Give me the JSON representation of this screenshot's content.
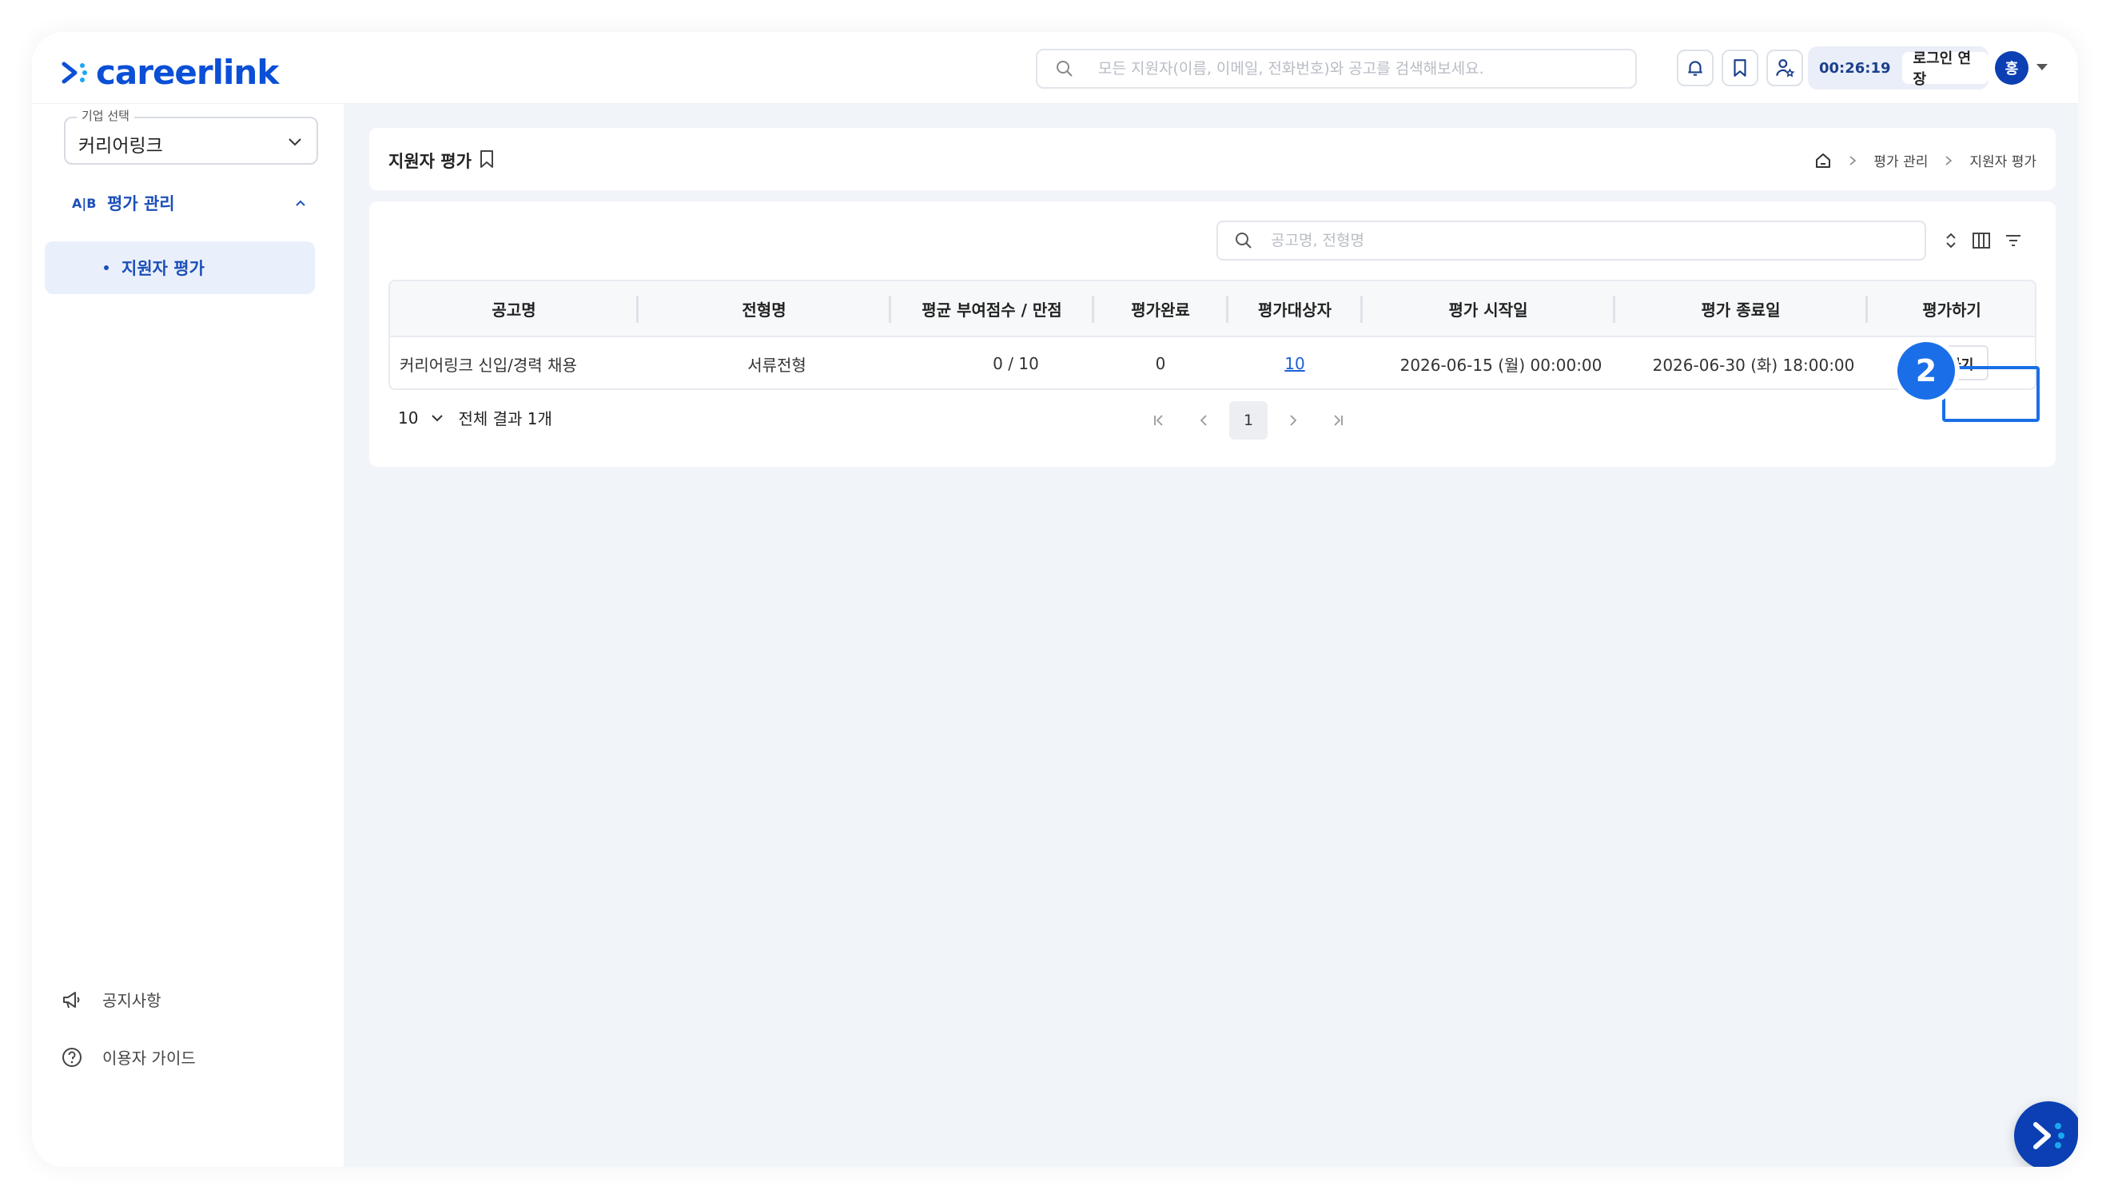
{
  "brand": {
    "name": "careerlink",
    "color": "#0b4fd6"
  },
  "header": {
    "search_placeholder": "모든 지원자(이름, 이메일, 전화번호)와 공고를 검색해보세요.",
    "icons": [
      "bell-icon",
      "bookmark-icon",
      "user-star-icon"
    ],
    "timer": "00:26:19",
    "extend_label": "로그인 연장",
    "avatar_initial": "홍"
  },
  "sidebar": {
    "company_legend": "기업 선택",
    "company_value": "커리어링크",
    "group": {
      "badge": "A|B",
      "label": "평가 관리"
    },
    "active_item": "지원자 평가",
    "bottom": [
      {
        "icon": "megaphone-icon",
        "label": "공지사항"
      },
      {
        "icon": "help-circle-icon",
        "label": "이용자 가이드"
      }
    ]
  },
  "page": {
    "title": "지원자 평가",
    "breadcrumb": [
      "평가 관리",
      "지원자 평가"
    ]
  },
  "table": {
    "search_placeholder": "공고명, 전형명",
    "columns": [
      "공고명",
      "전형명",
      "평균 부여점수 / 만점",
      "평가완료",
      "평가대상자",
      "평가 시작일",
      "평가 종료일",
      "평가하기"
    ],
    "rows": [
      {
        "posting": "커리어링크 신입/경력 채용",
        "stage": "서류전형",
        "score": "0 / 10",
        "completed": "0",
        "targets": "10",
        "start": "2026-06-15 (월) 00:00:00",
        "end": "2026-06-30 (화) 18:00:00",
        "action": "평가하기"
      }
    ],
    "page_size": "10",
    "total_label": "전체 결과 1개",
    "current_page": "1"
  },
  "annotation": {
    "step": "2",
    "color": "#1a6fe8"
  }
}
